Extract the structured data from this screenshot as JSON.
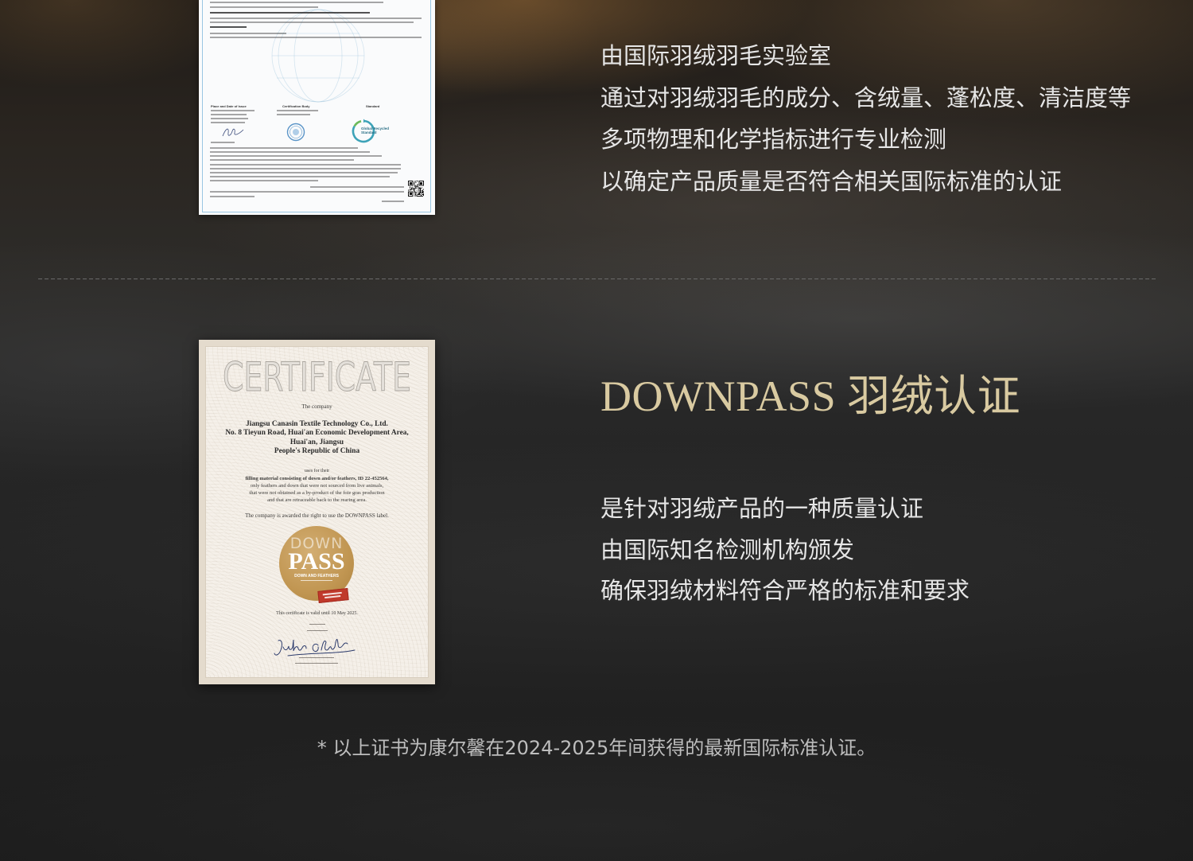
{
  "colors": {
    "background": "#1e1d1c",
    "body_text": "#e6e6e6",
    "title_gold": "#d9caa1",
    "footnote_text": "#bdbdbd",
    "divider": "#6a6a6a",
    "badge_gold": "#c19652",
    "grs_frame_blue": "#9ac6e2"
  },
  "grs_section": {
    "certificate": {
      "signature_headers": [
        "Place and Date of Issue",
        "Certification Body",
        "Standard"
      ],
      "logo_text": [
        "Global Recycled",
        "Standard"
      ],
      "icons": [
        "globe-watermark-icon",
        "signature-icon",
        "certification-seal-icon",
        "grs-logo-icon",
        "qr-code-icon"
      ]
    },
    "description_lines": [
      "由国际羽绒羽毛实验室",
      "通过对羽绒羽毛的成分、含绒量、蓬松度、清洁度等",
      "多项物理和化学指标进行专业检测",
      "以确定产品质量是否符合相关国际标准的认证"
    ]
  },
  "downpass_section": {
    "title": "DOWNPASS 羽绒认证",
    "certificate": {
      "heading": "CERTIFICATE",
      "intro": "The company",
      "company_lines": [
        "Jiangsu Canasin Textile Technology Co., Ltd.",
        "No. 8 Tieyun Road, Huai'an Economic Development Area,",
        "Huai'an, Jiangsu",
        "People's Republic of China"
      ],
      "uses_for": "uses for their",
      "material_lines": [
        "filling material consisting of down and/or feathers, ID 22-452564,",
        "only feathers and down that were not sourced from live animals,",
        "that were not obtained as a by-product of the foie gras production",
        "and that are retraceable back to the rearing area."
      ],
      "award_line": "The company is awarded the right to use the DOWNPASS label.",
      "badge": {
        "top": "DOWN",
        "main": "PASS",
        "sub": "DOWN AND FEATHERS"
      },
      "validity": "This certificate is valid until 10 May 2025.",
      "icons": [
        "downpass-badge-icon",
        "red-stamp-icon",
        "signature-icon"
      ]
    },
    "description_lines": [
      "是针对羽绒产品的一种质量认证",
      "由国际知名检测机构颁发",
      "确保羽绒材料符合严格的标准和要求"
    ]
  },
  "footnote": "* 以上证书为康尔馨在2024-2025年间获得的最新国际标准认证。"
}
